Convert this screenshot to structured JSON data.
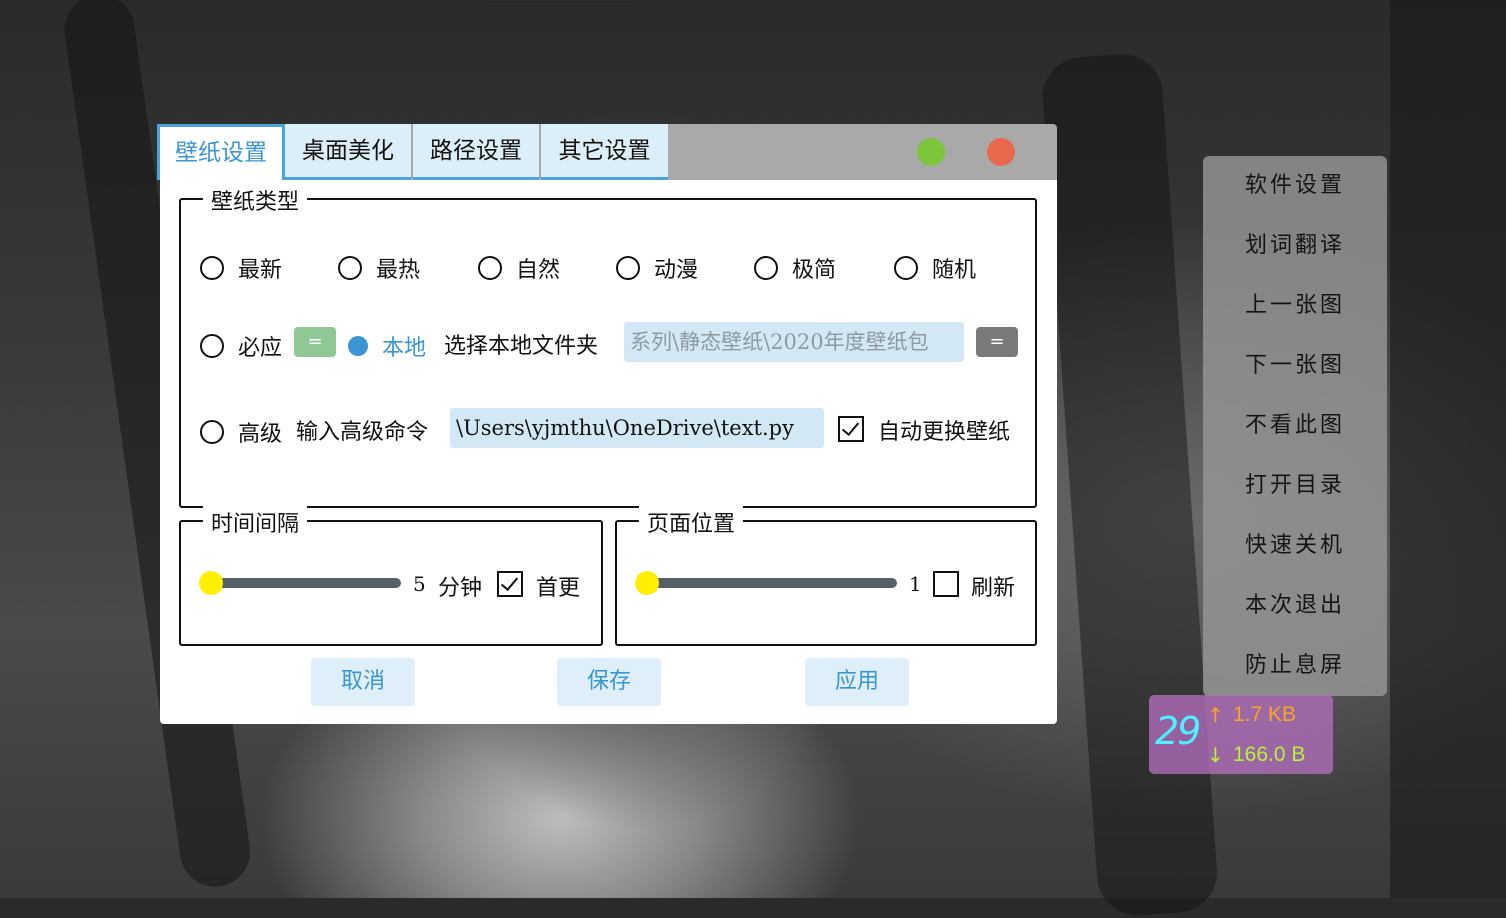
{
  "window": {
    "tabs": [
      "壁纸设置",
      "桌面美化",
      "路径设置",
      "其它设置"
    ],
    "active_tab": 0,
    "controls": {
      "minimize_color": "#7dc63a",
      "close_color": "#e9694c"
    }
  },
  "wallpaper_type": {
    "title": "壁纸类型",
    "options": [
      "最新",
      "最热",
      "自然",
      "动漫",
      "极简",
      "随机"
    ],
    "bing_label": "必应",
    "bing_button": "=",
    "local_label": "本地",
    "local_selected": true,
    "local_folder_label": "选择本地文件夹",
    "local_folder_value": "系列\\静态壁纸\\2020年度壁纸包",
    "local_folder_button": "=",
    "advanced_label": "高级",
    "advanced_cmd_label": "输入高级命令",
    "advanced_cmd_value": "\\Users\\yjmthu\\OneDrive\\text.py",
    "auto_change_label": "自动更换壁纸",
    "auto_change_checked": true
  },
  "interval": {
    "title": "时间间隔",
    "value": "5",
    "unit": "分钟",
    "first_change_label": "首更",
    "first_change_checked": true,
    "slider_fraction": 0.0
  },
  "page": {
    "title": "页面位置",
    "value": "1",
    "refresh_label": "刷新",
    "refresh_checked": false,
    "slider_fraction": 0.0
  },
  "buttons": {
    "cancel": "取消",
    "save": "保存",
    "apply": "应用"
  },
  "menu": [
    "软件设置",
    "划词翻译",
    "上一张图",
    "下一张图",
    "不看此图",
    "打开目录",
    "快速关机",
    "本次退出",
    "防止息屏"
  ],
  "net_widget": {
    "percent": "29",
    "upload": "1.7 KB",
    "download": "166.0 B",
    "up_arrow": "↑",
    "down_arrow": "↓",
    "upload_color": "#f5a623",
    "download_color": "#b6f23a",
    "percent_color": "#4df0ff"
  }
}
